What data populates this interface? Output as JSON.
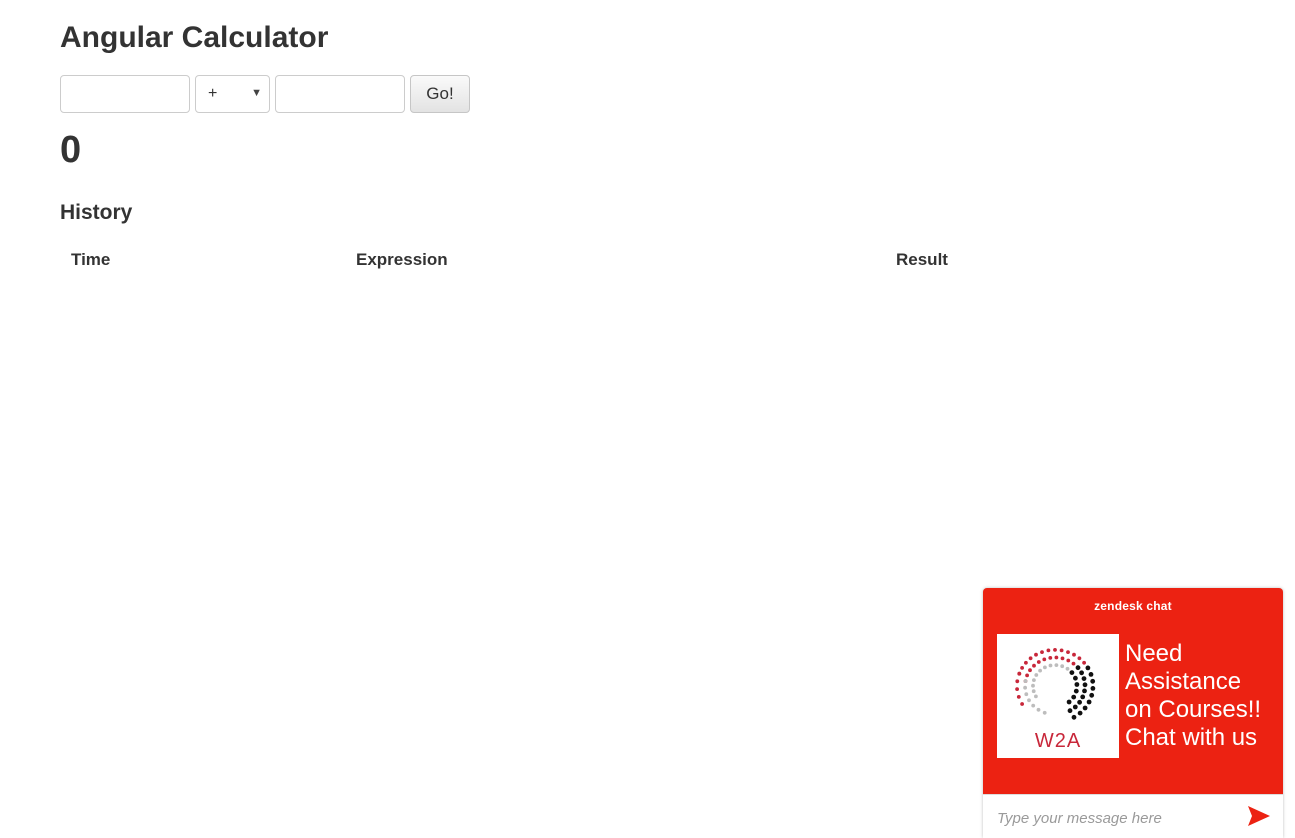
{
  "page": {
    "title": "Angular Calculator"
  },
  "calculator": {
    "first_operand": "",
    "operator": {
      "selected": "+",
      "icon": "chevron-down-icon"
    },
    "second_operand": "",
    "go_label": "Go!",
    "result": "0"
  },
  "history": {
    "title": "History",
    "columns": [
      "Time",
      "Expression",
      "Result"
    ],
    "rows": []
  },
  "chat": {
    "brand": "zendesk chat",
    "logo_text": "W2A",
    "message_lines": [
      "Need",
      "Assistance",
      "on Courses!!",
      "Chat with us"
    ],
    "input_placeholder": "Type your message here",
    "send_icon": "send-icon",
    "accent_color": "#ec2212"
  }
}
